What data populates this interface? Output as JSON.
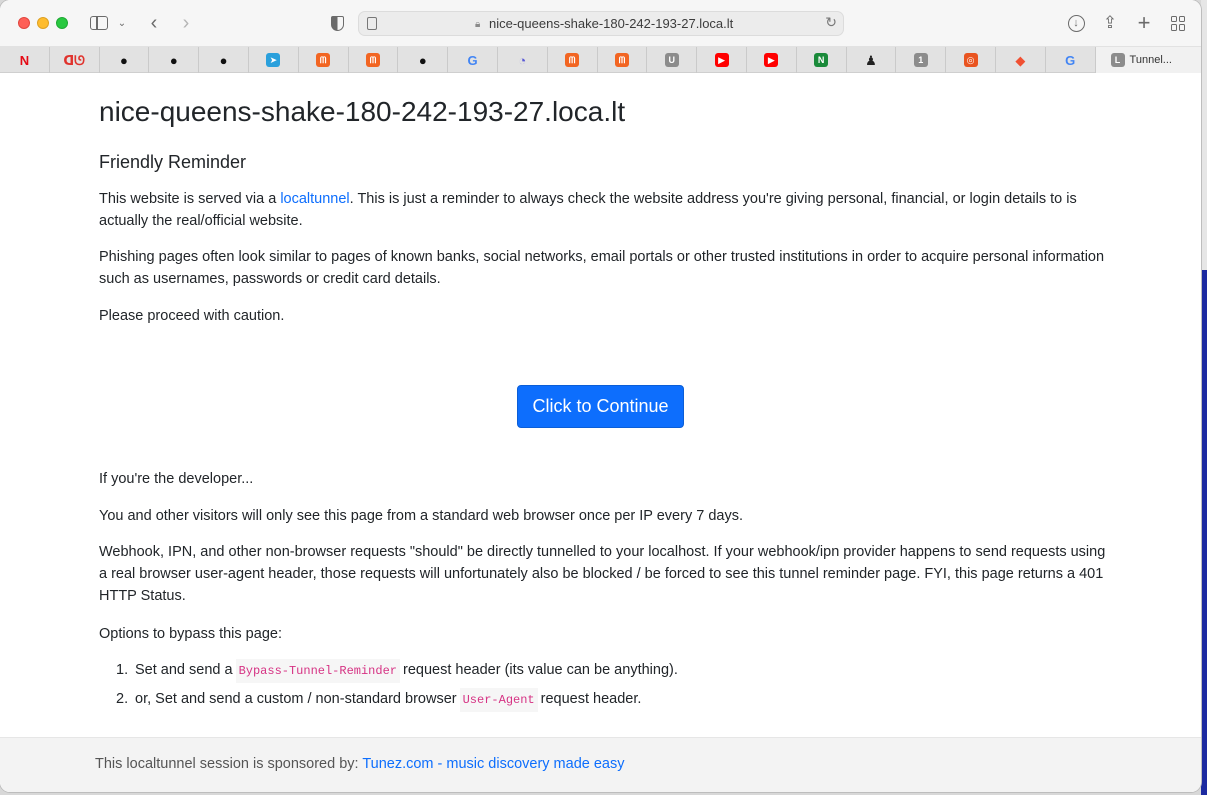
{
  "browser": {
    "url": "nice-queens-shake-180-242-193-27.loca.lt",
    "active_tab_label": "Tunnel...",
    "active_tab_icon_letter": "L"
  },
  "bookmarks": [
    {
      "icon": "netflix-icon",
      "glyph": "N",
      "color": "#e50914",
      "bg": "transparent"
    },
    {
      "icon": "bookmark-icon",
      "glyph": "ᗡᘎ",
      "color": "#e0332d",
      "bg": "transparent"
    },
    {
      "icon": "github-icon",
      "glyph": "●",
      "color": "#111",
      "bg": "transparent"
    },
    {
      "icon": "github-icon",
      "glyph": "●",
      "color": "#111",
      "bg": "transparent"
    },
    {
      "icon": "github-icon",
      "glyph": "●",
      "color": "#111",
      "bg": "transparent"
    },
    {
      "icon": "telegram-icon",
      "glyph": "➤",
      "color": "#fff",
      "bg": "#2aa0dc"
    },
    {
      "icon": "bookmark-orange-icon",
      "glyph": "ᗰ",
      "color": "#fff",
      "bg": "#f26522"
    },
    {
      "icon": "bookmark-orange-icon",
      "glyph": "ᗰ",
      "color": "#fff",
      "bg": "#f26522"
    },
    {
      "icon": "github-icon",
      "glyph": "●",
      "color": "#111",
      "bg": "transparent"
    },
    {
      "icon": "google-icon",
      "glyph": "G",
      "color": "#4285f4",
      "bg": "transparent"
    },
    {
      "icon": "swirl-icon",
      "glyph": "◔",
      "color": "#5b5bd6",
      "bg": "transparent"
    },
    {
      "icon": "bookmark-orange-icon",
      "glyph": "ᗰ",
      "color": "#fff",
      "bg": "#f26522"
    },
    {
      "icon": "bookmark-orange-icon",
      "glyph": "ᗰ",
      "color": "#fff",
      "bg": "#f26522"
    },
    {
      "icon": "u-letter-icon",
      "glyph": "U",
      "color": "#fff",
      "bg": "#8c8c8c"
    },
    {
      "icon": "youtube-icon",
      "glyph": "▶",
      "color": "#fff",
      "bg": "#ff0000"
    },
    {
      "icon": "youtube-icon",
      "glyph": "▶",
      "color": "#fff",
      "bg": "#ff0000"
    },
    {
      "icon": "n-hex-icon",
      "glyph": "N",
      "color": "#fff",
      "bg": "#1a8a3a"
    },
    {
      "icon": "penguin-icon",
      "glyph": "♟",
      "color": "#222",
      "bg": "transparent"
    },
    {
      "icon": "one-letter-icon",
      "glyph": "1",
      "color": "#fff",
      "bg": "#8c8c8c"
    },
    {
      "icon": "ubuntu-icon",
      "glyph": "◎",
      "color": "#fff",
      "bg": "#e95420"
    },
    {
      "icon": "git-icon",
      "glyph": "◆",
      "color": "#f05032",
      "bg": "transparent"
    },
    {
      "icon": "google-icon",
      "glyph": "G",
      "color": "#4285f4",
      "bg": "transparent"
    }
  ],
  "page": {
    "title": "nice-queens-shake-180-242-193-27.loca.lt",
    "subtitle": "Friendly Reminder",
    "p1_before": "This website is served via a ",
    "p1_link": "localtunnel",
    "p1_after": ". This is just a reminder to always check the website address you're giving personal, financial, or login details to is actually the real/official website.",
    "p2": "Phishing pages often look similar to pages of known banks, social networks, email portals or other trusted institutions in order to acquire personal information such as usernames, passwords or credit card details.",
    "p3": "Please proceed with caution.",
    "button": "Click to Continue",
    "dev_heading": "If you're the developer...",
    "p4": "You and other visitors will only see this page from a standard web browser once per IP every 7 days.",
    "p5": "Webhook, IPN, and other non-browser requests \"should\" be directly tunnelled to your localhost. If your webhook/ipn provider happens to send requests using a real browser user-agent header, those requests will unfortunately also be blocked / be forced to see this tunnel reminder page. FYI, this page returns a 401 HTTP Status.",
    "options_heading": "Options to bypass this page:",
    "options": [
      {
        "num": "1.",
        "before": "Set and send a",
        "code": "Bypass-Tunnel-Reminder",
        "after": "request header (its value can be anything)."
      },
      {
        "num": "2.",
        "before": "or, Set and send a custom / non-standard browser",
        "code": "User-Agent",
        "after": "request header."
      }
    ],
    "footer_text": "This localtunnel session is sponsored by: ",
    "footer_link": "Tunez.com - music discovery made easy"
  }
}
